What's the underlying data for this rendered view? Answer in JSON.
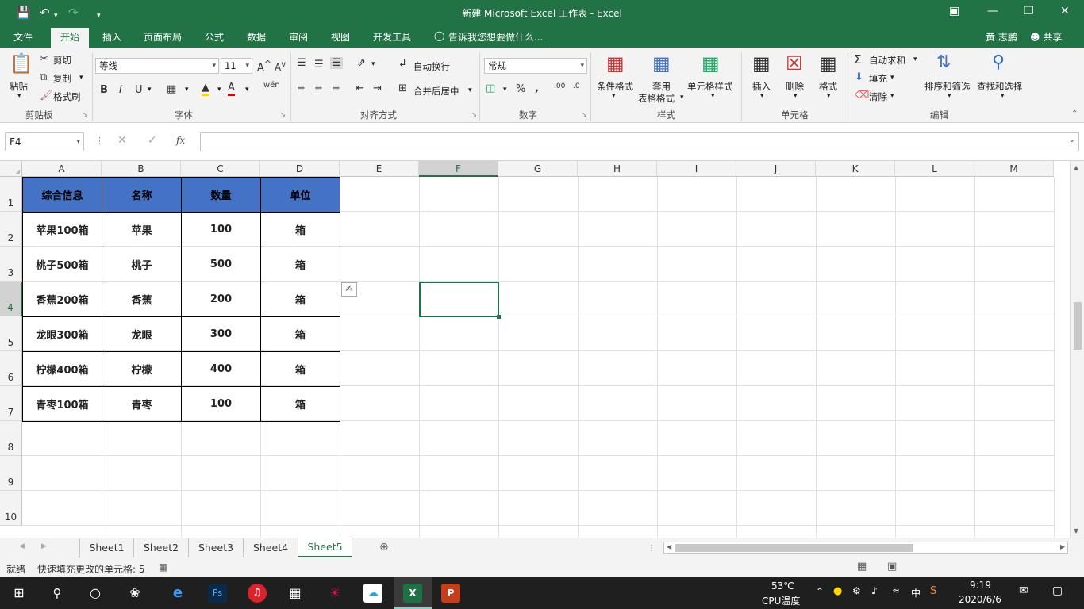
{
  "window": {
    "title": "新建 Microsoft Excel 工作表 - Excel"
  },
  "tabs": [
    "文件",
    "开始",
    "插入",
    "页面布局",
    "公式",
    "数据",
    "审阅",
    "视图",
    "开发工具"
  ],
  "tell_me": "告诉我您想要做什么...",
  "user": "黄 志鹏",
  "share": "共享",
  "ribbon": {
    "clipboard": {
      "paste": "粘贴",
      "cut": "剪切",
      "copy": "复制",
      "format_painter": "格式刷",
      "label": "剪贴板"
    },
    "font": {
      "name": "等线",
      "size": "11",
      "label": "字体"
    },
    "alignment": {
      "wrap": "自动换行",
      "merge": "合并后居中",
      "label": "对齐方式"
    },
    "number": {
      "format": "常规",
      "label": "数字"
    },
    "styles": {
      "cond": "条件格式",
      "table1": "套用",
      "table2": "表格格式",
      "cell": "单元格样式",
      "label": "样式"
    },
    "cells": {
      "insert": "插入",
      "delete": "删除",
      "format": "格式",
      "label": "单元格"
    },
    "editing": {
      "autosum": "自动求和",
      "fill": "填充",
      "clear": "清除",
      "sort": "排序和筛选",
      "find": "查找和选择",
      "label": "编辑"
    }
  },
  "namebox": "F4",
  "columns": [
    "A",
    "B",
    "C",
    "D",
    "E",
    "F",
    "G",
    "H",
    "I",
    "J",
    "K",
    "L",
    "M"
  ],
  "rows": [
    "1",
    "2",
    "3",
    "4",
    "5",
    "6",
    "7",
    "8",
    "9",
    "10"
  ],
  "table": {
    "headers": [
      "综合信息",
      "名称",
      "数量",
      "单位"
    ],
    "rows": [
      [
        "苹果100箱",
        "苹果",
        "100",
        "箱"
      ],
      [
        "桃子500箱",
        "桃子",
        "500",
        "箱"
      ],
      [
        "香蕉200箱",
        "香蕉",
        "200",
        "箱"
      ],
      [
        "龙眼300箱",
        "龙眼",
        "300",
        "箱"
      ],
      [
        "柠檬400箱",
        "柠檬",
        "400",
        "箱"
      ],
      [
        "青枣100箱",
        "青枣",
        "100",
        "箱"
      ]
    ]
  },
  "sheets": [
    "Sheet1",
    "Sheet2",
    "Sheet3",
    "Sheet4",
    "Sheet5"
  ],
  "active_sheet": "Sheet5",
  "status": {
    "ready": "就绪",
    "message": "快速填充更改的单元格: 5"
  },
  "taskbar": {
    "temp": "53℃",
    "temp_label": "CPU温度",
    "ime": "中",
    "time": "9:19",
    "date": "2020/6/6"
  },
  "colors": {
    "excel_green": "#217346",
    "header_fill": "#4472c4"
  }
}
